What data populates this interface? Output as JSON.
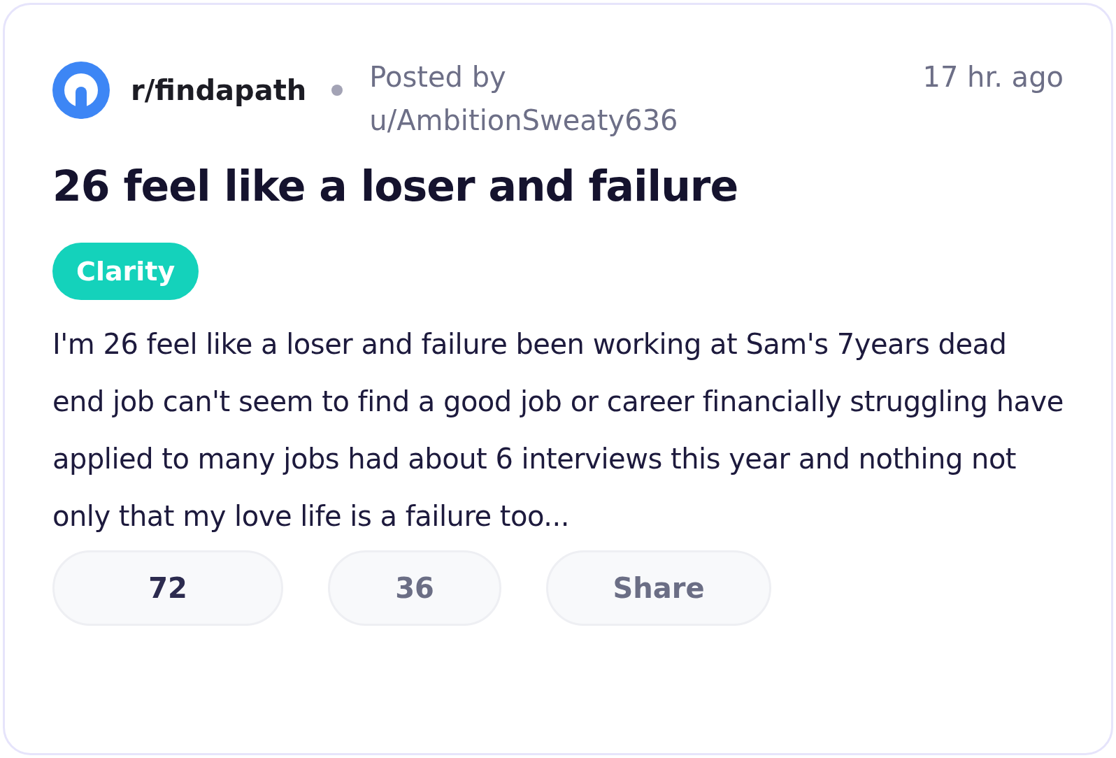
{
  "post": {
    "subreddit": "r/findapath",
    "posted_by_label": "Posted by",
    "author": "u/AmbitionSweaty636",
    "time": "17 hr. ago",
    "title": "26 feel like a loser and failure",
    "flair": "Clarity",
    "body": "I'm 26 feel like a loser and failure been working at Sam's 7years dead end job can't seem to find a good job or career financially struggling have applied to many jobs had about 6 interviews this year and nothing not only that my love life is a failure too...",
    "actions": [
      {
        "label": "72",
        "active": true
      },
      {
        "label": "36",
        "active": false
      },
      {
        "label": "Share",
        "active": false
      }
    ]
  }
}
